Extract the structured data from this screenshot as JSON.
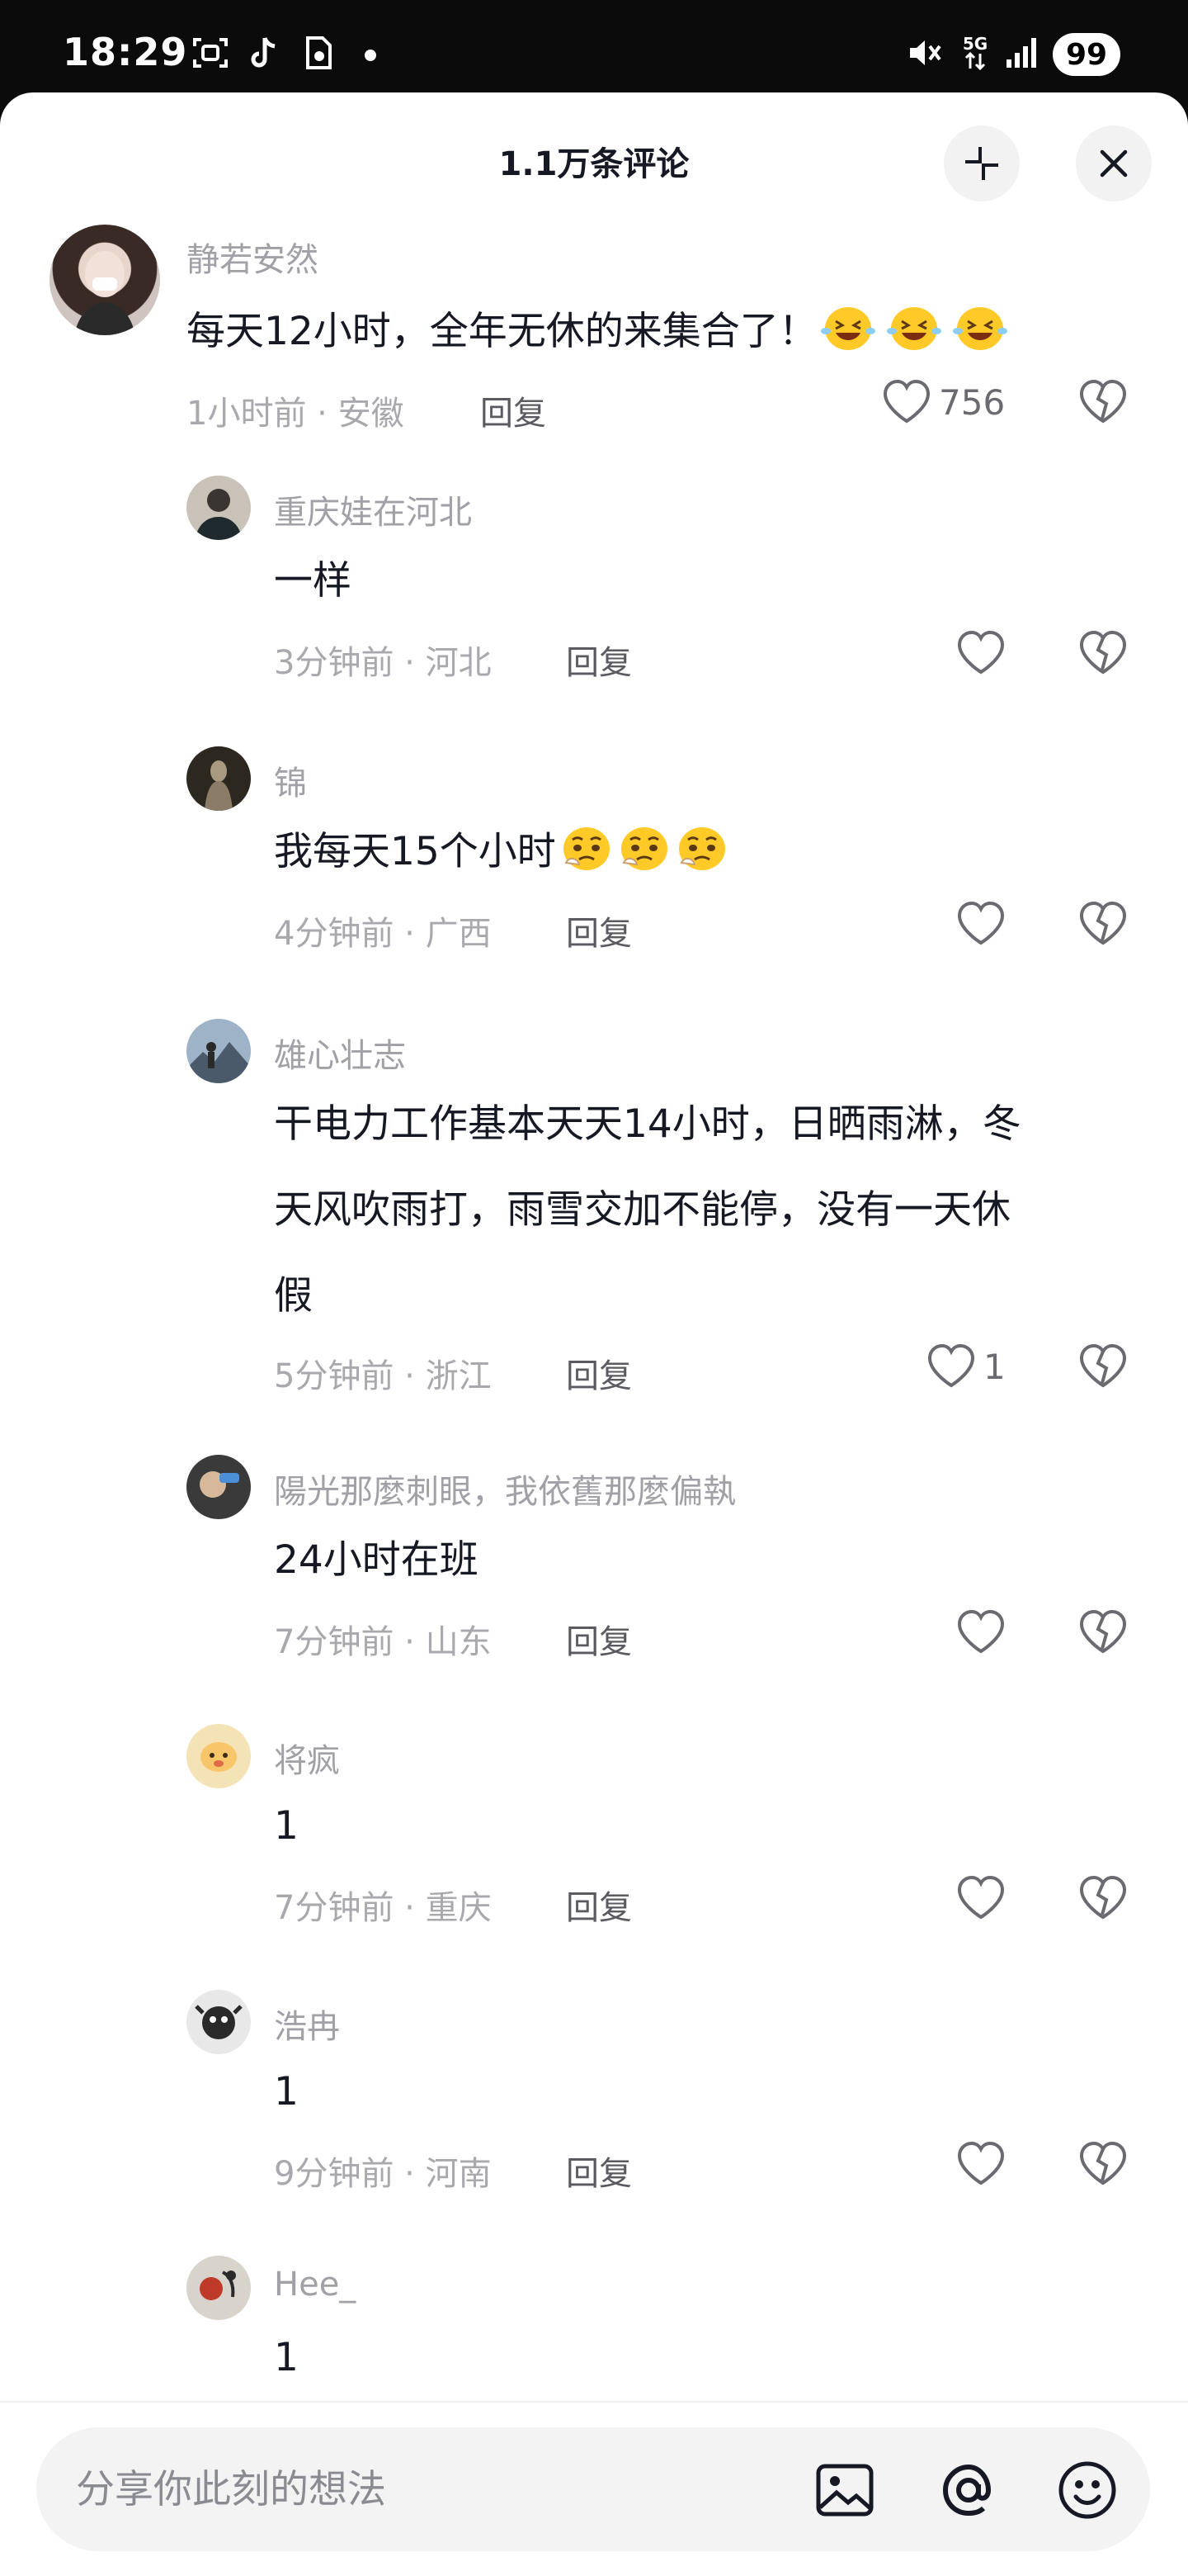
{
  "status_bar": {
    "time": "18:29",
    "network": "5G",
    "battery": "99"
  },
  "sheet": {
    "title": "1.1万条评论"
  },
  "comments": [
    {
      "name": "静若安然",
      "text": "每天12小时，全年无休的来集合了！",
      "emoji": "laughing-wink-emoji",
      "meta": "1小时前 · 安徽",
      "reply": "回复",
      "likes": "756"
    },
    {
      "name": "重庆娃在河北",
      "text": "一样",
      "meta": "3分钟前 · 河北",
      "reply": "回复",
      "likes": ""
    },
    {
      "name": "锦",
      "text": "我每天15个小时",
      "emoji": "pleading-emoji",
      "meta": "4分钟前 · 广西",
      "reply": "回复",
      "likes": ""
    },
    {
      "name": "雄心壮志",
      "text_lines": [
        "干电力工作基本天天14小时，日晒雨淋，冬",
        "天风吹雨打，雨雪交加不能停，没有一天休",
        "假"
      ],
      "meta": "5分钟前 · 浙江",
      "reply": "回复",
      "likes": "1"
    },
    {
      "name": "陽光那麼刺眼，我依舊那麼偏執",
      "text": "24小时在班",
      "meta": "7分钟前 · 山东",
      "reply": "回复",
      "likes": ""
    },
    {
      "name": "将疯",
      "text": "1",
      "meta": "7分钟前 · 重庆",
      "reply": "回复",
      "likes": ""
    },
    {
      "name": "浩冉",
      "text": "1",
      "meta": "9分钟前 · 河南",
      "reply": "回复",
      "likes": ""
    },
    {
      "name": "Hee_",
      "text": "1"
    }
  ],
  "input": {
    "placeholder": "分享你此刻的想法"
  },
  "colors": {
    "text_primary": "#161823",
    "text_secondary": "#a0a0a6",
    "sheet_bg": "#ffffff",
    "status_bg": "#0b0b0b",
    "emoji_yellow": "#ffc928"
  }
}
